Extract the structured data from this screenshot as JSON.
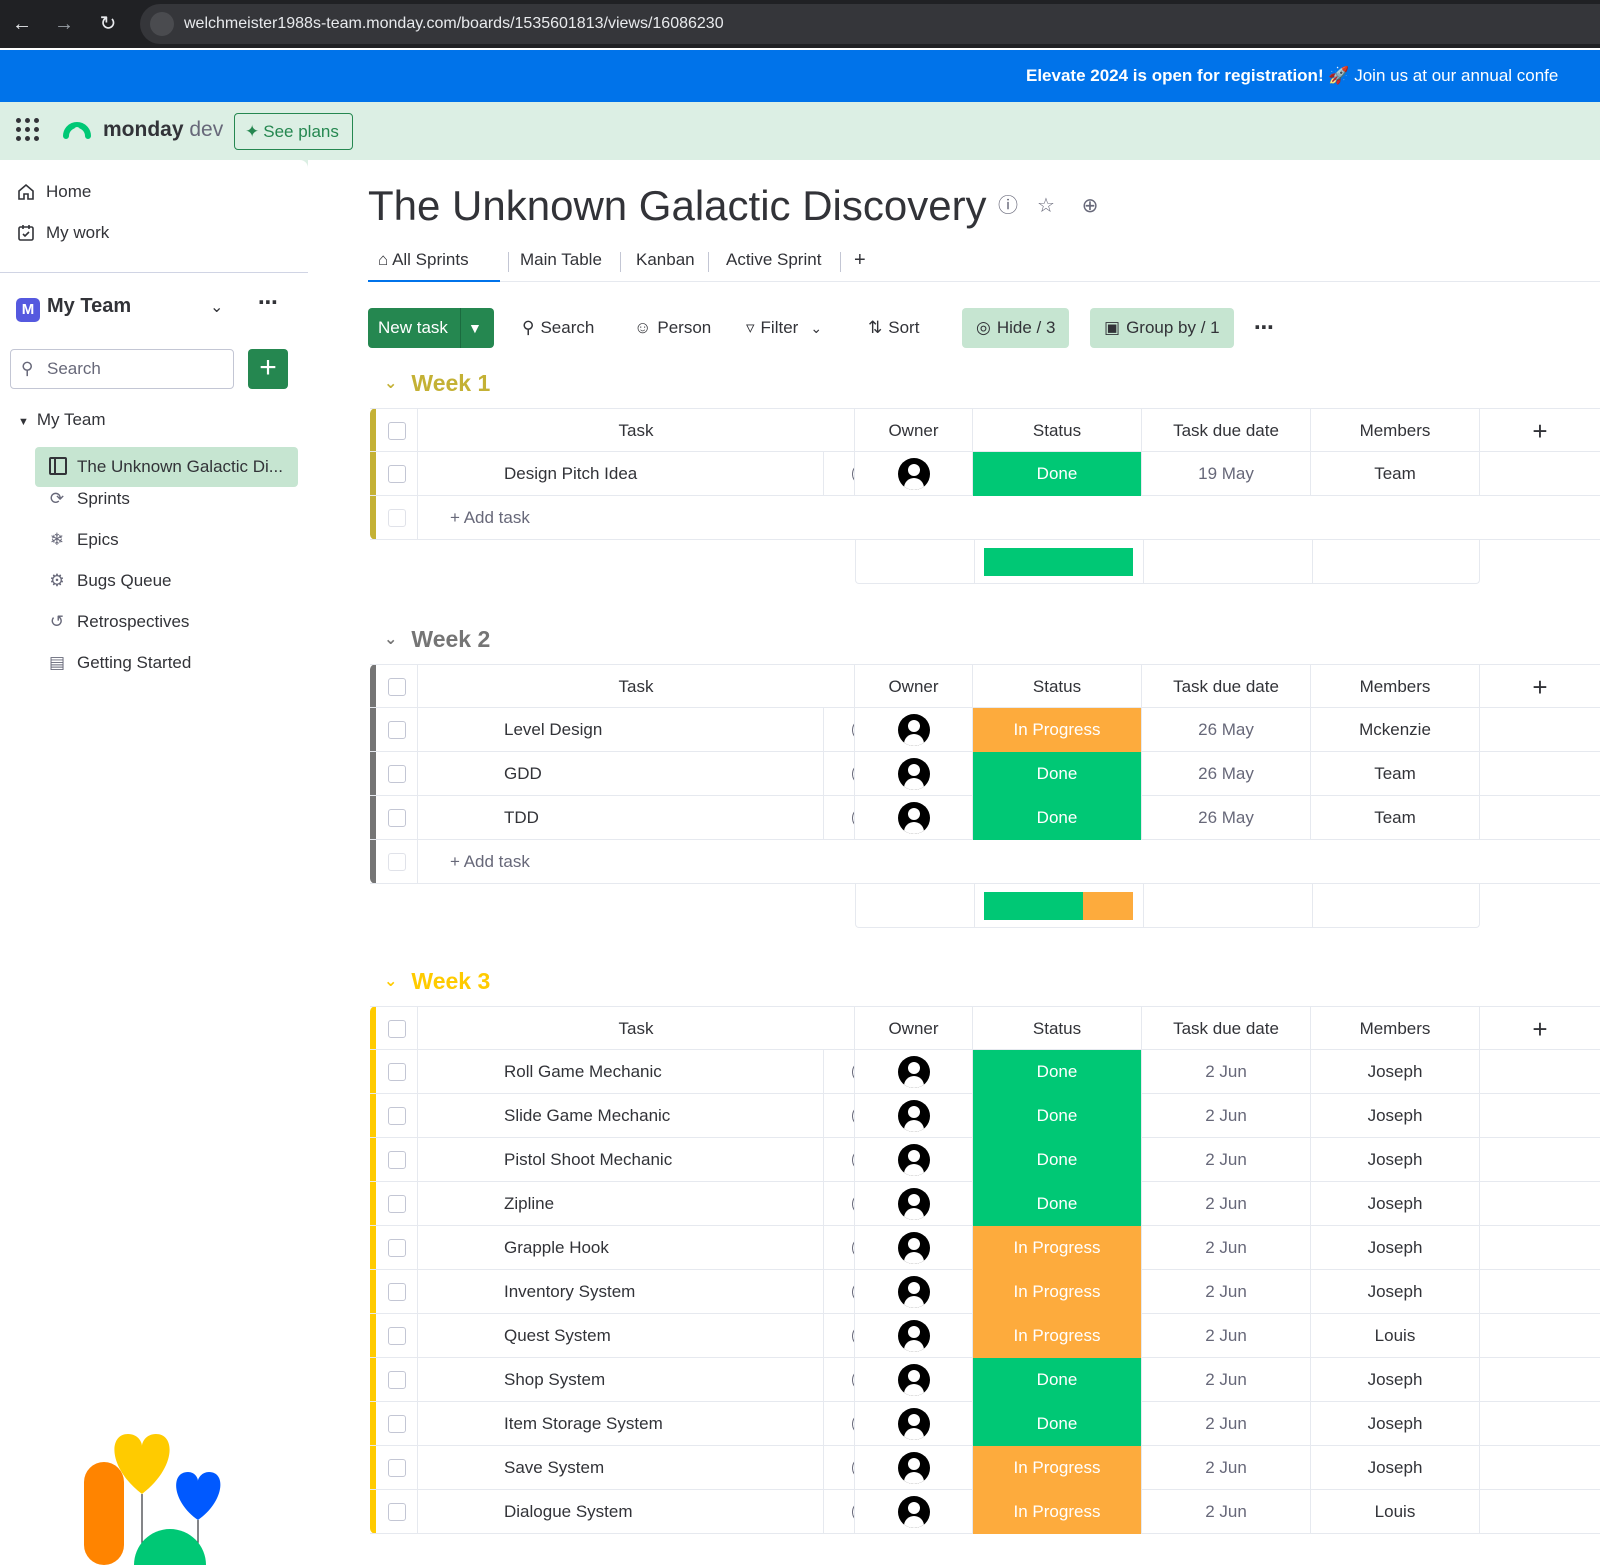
{
  "browser": {
    "url": "welchmeister1988s-team.monday.com/boards/1535601813/views/16086230"
  },
  "announcement": {
    "bold": "Elevate 2024 is open for registration!",
    "text": " 🚀 Join us at our annual confe"
  },
  "topbar": {
    "logo_bold": "monday",
    "logo_light": " dev",
    "see_plans": "See plans"
  },
  "sidebar": {
    "home": "Home",
    "my_work": "My work",
    "workspace_initial": "M",
    "workspace_name": "My Team",
    "search_placeholder": "Search",
    "tree_root": "My Team",
    "active_board": "The Unknown Galactic Di...",
    "items": [
      {
        "label": "Sprints",
        "icon": "sprint-icon"
      },
      {
        "label": "Epics",
        "icon": "epic-icon"
      },
      {
        "label": "Bugs Queue",
        "icon": "bug-icon"
      },
      {
        "label": "Retrospectives",
        "icon": "history-icon"
      },
      {
        "label": "Getting Started",
        "icon": "doc-icon"
      }
    ]
  },
  "board": {
    "title": "The Unknown Galactic Discovery",
    "tabs": [
      "All Sprints",
      "Main Table",
      "Kanban",
      "Active Sprint",
      "+"
    ],
    "toolbar": {
      "new_task": "New task",
      "search": "Search",
      "person": "Person",
      "filter": "Filter",
      "sort": "Sort",
      "hide": "Hide / 3",
      "group_by": "Group by / 1"
    },
    "columns": [
      "Task",
      "Owner",
      "Status",
      "Task due date",
      "Members"
    ],
    "add_task": "+ Add task"
  },
  "colors": {
    "done": "#00c875",
    "in_progress": "#fdab3d",
    "week1": "#c4b135",
    "week2": "#757575",
    "week3": "#ffcb00"
  },
  "groups": [
    {
      "name": "Week 1",
      "tasks": [
        {
          "task": "Design Pitch Idea",
          "status": "Done",
          "due": "19 May",
          "members": "Team"
        }
      ],
      "summary": {
        "done": 1,
        "in_progress": 0
      }
    },
    {
      "name": "Week 2",
      "tasks": [
        {
          "task": "Level Design",
          "status": "In Progress",
          "due": "26 May",
          "members": "Mckenzie"
        },
        {
          "task": "GDD",
          "status": "Done",
          "due": "26 May",
          "members": "Team"
        },
        {
          "task": "TDD",
          "status": "Done",
          "due": "26 May",
          "members": "Team"
        }
      ],
      "summary": {
        "done": 2,
        "in_progress": 1
      }
    },
    {
      "name": "Week 3",
      "tasks": [
        {
          "task": "Roll Game Mechanic",
          "status": "Done",
          "due": "2 Jun",
          "members": "Joseph"
        },
        {
          "task": "Slide Game Mechanic",
          "status": "Done",
          "due": "2 Jun",
          "members": "Joseph"
        },
        {
          "task": "Pistol Shoot Mechanic",
          "status": "Done",
          "due": "2 Jun",
          "members": "Joseph"
        },
        {
          "task": "Zipline",
          "status": "Done",
          "due": "2 Jun",
          "members": "Joseph"
        },
        {
          "task": "Grapple Hook",
          "status": "In Progress",
          "due": "2 Jun",
          "members": "Joseph"
        },
        {
          "task": "Inventory System",
          "status": "In Progress",
          "due": "2 Jun",
          "members": "Joseph"
        },
        {
          "task": "Quest System",
          "status": "In Progress",
          "due": "2 Jun",
          "members": "Louis"
        },
        {
          "task": "Shop System",
          "status": "Done",
          "due": "2 Jun",
          "members": "Joseph"
        },
        {
          "task": "Item Storage System",
          "status": "Done",
          "due": "2 Jun",
          "members": "Joseph"
        },
        {
          "task": "Save System",
          "status": "In Progress",
          "due": "2 Jun",
          "members": "Joseph"
        },
        {
          "task": "Dialogue System",
          "status": "In Progress",
          "due": "2 Jun",
          "members": "Louis"
        }
      ]
    }
  ]
}
